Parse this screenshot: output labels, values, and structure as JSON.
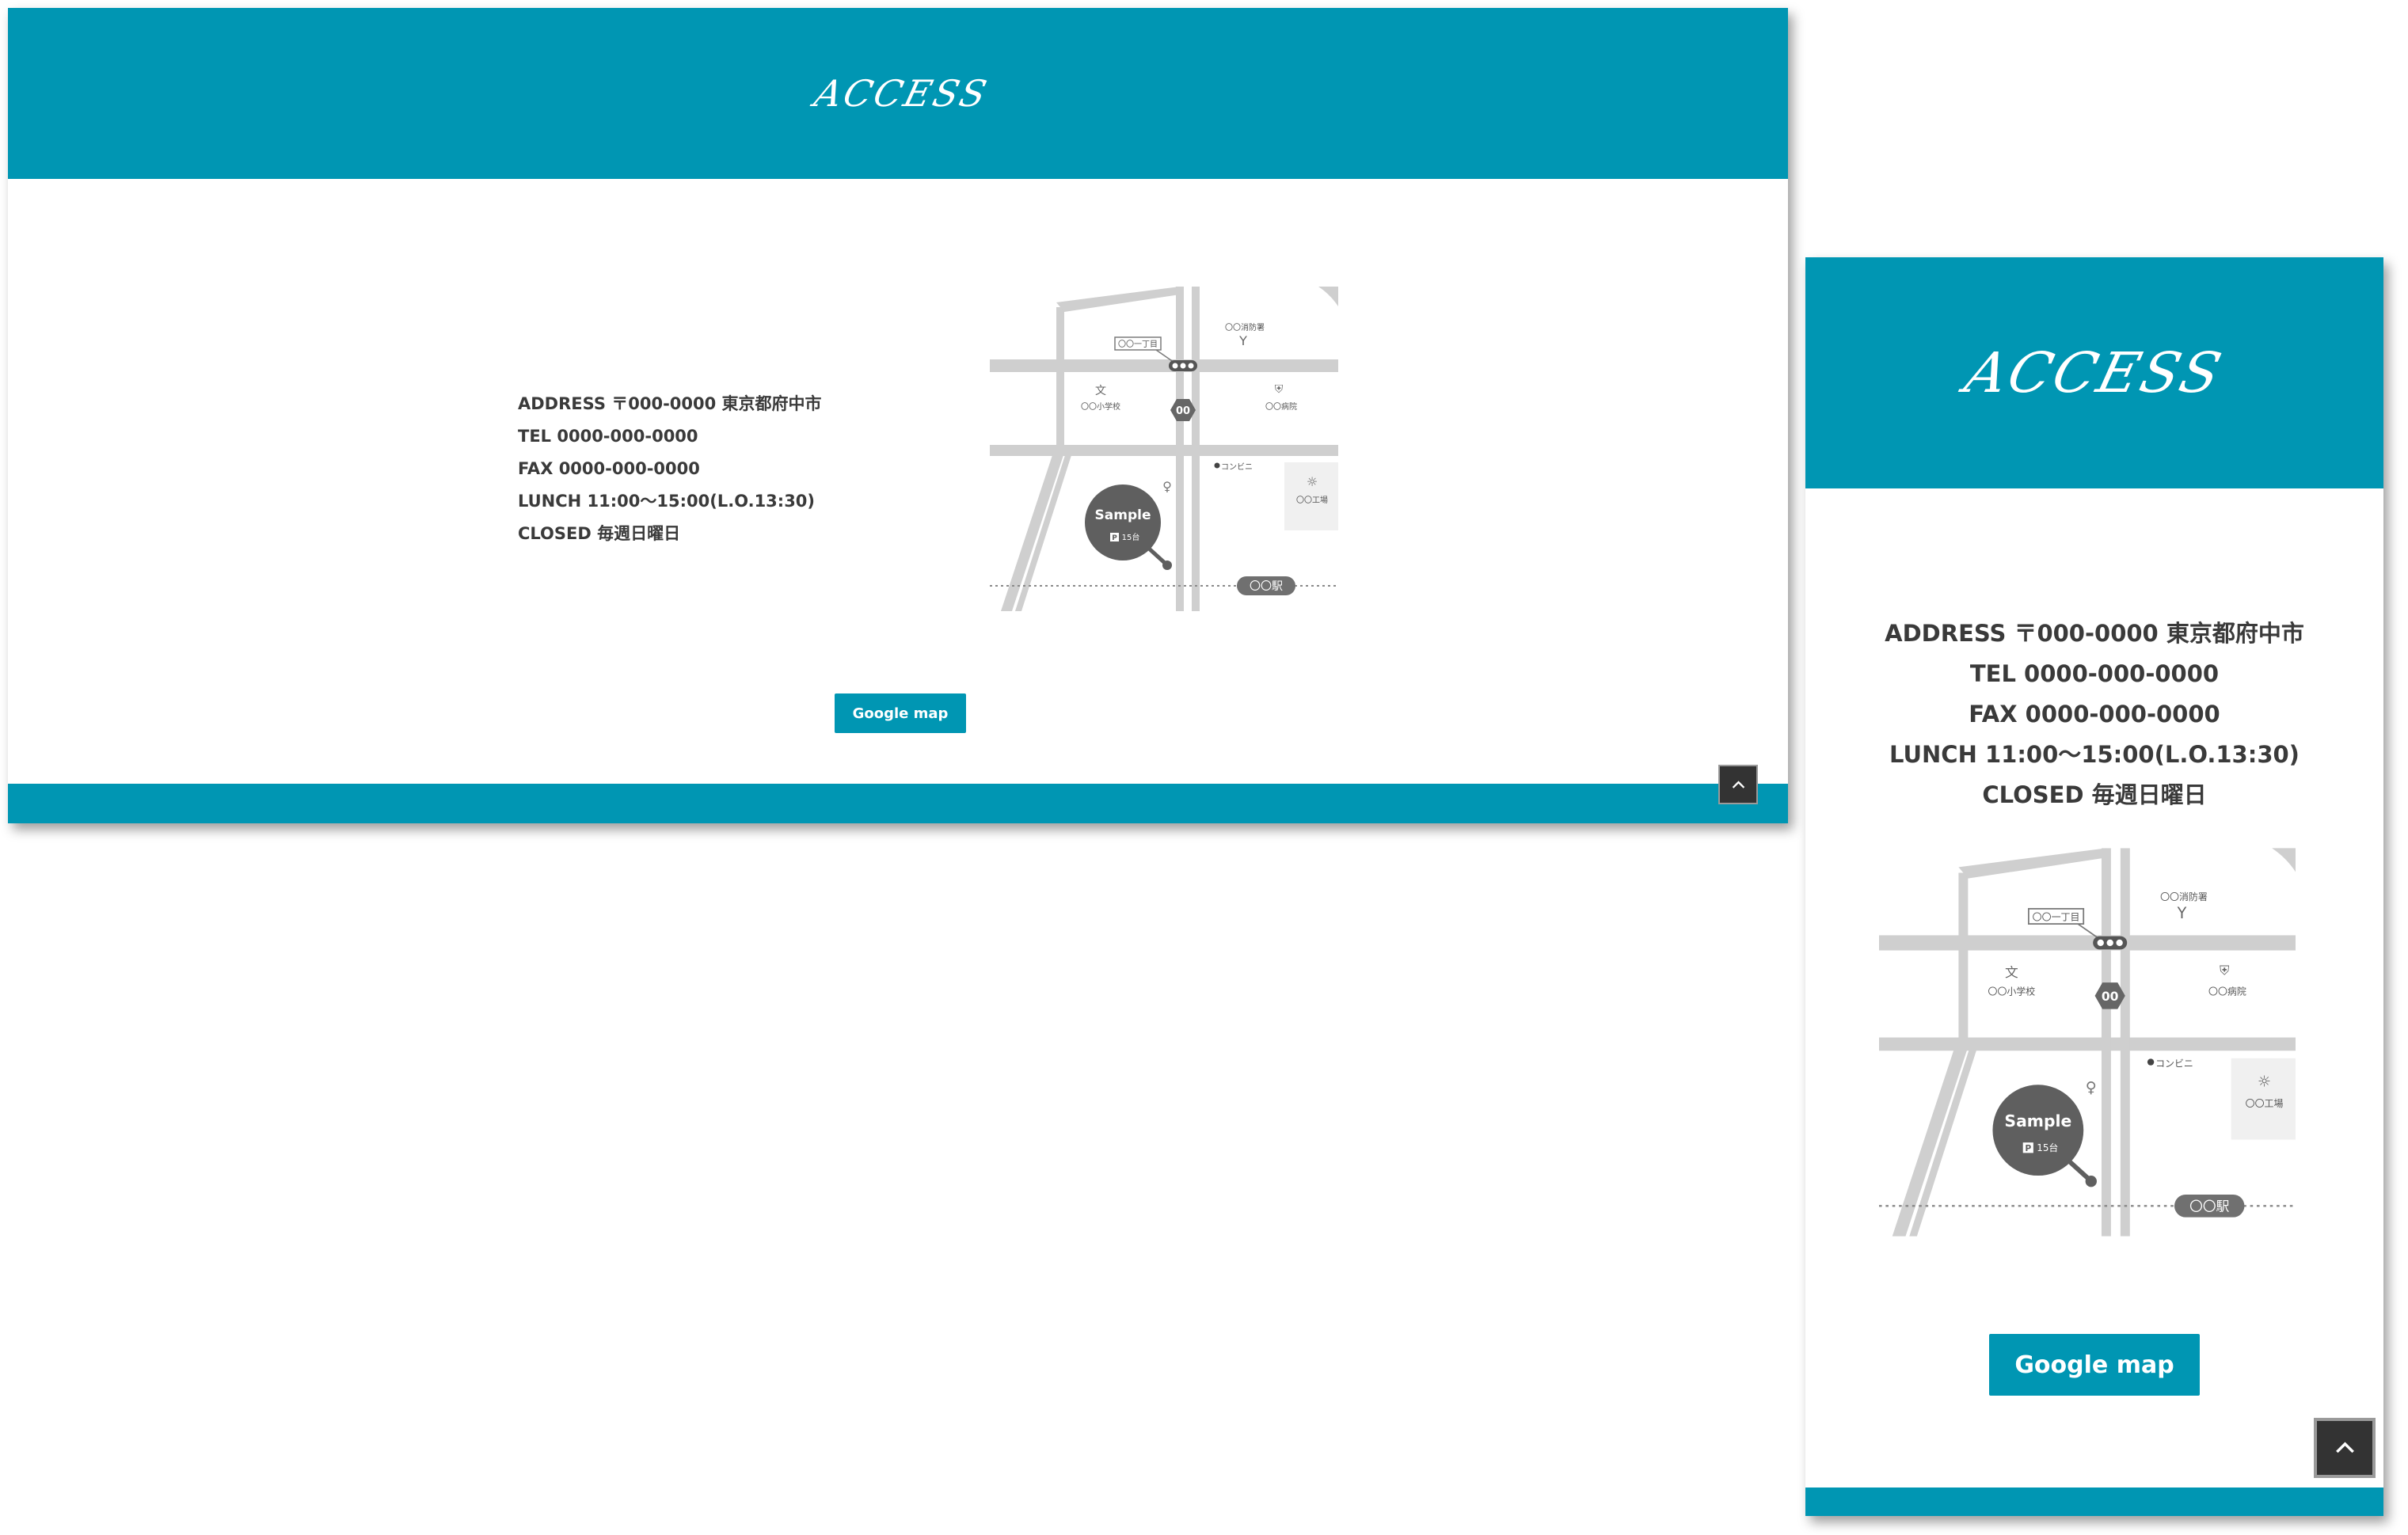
{
  "section": {
    "title": "ACCESS",
    "colors": {
      "accent": "#0096b3",
      "text": "#3a3a3a",
      "road": "#cfcfcf",
      "marker": "#5f5f5f",
      "totop_bg": "#333333"
    }
  },
  "info": {
    "address": "ADDRESS 〒000-0000 東京都府中市",
    "tel": "TEL 0000-000-0000",
    "fax": "FAX 0000-000-0000",
    "lunch": "LUNCH 11:00～15:00(L.O.13:30)",
    "closed": "CLOSED 毎週日曜日"
  },
  "map": {
    "marker_label": "Sample",
    "parking": "P",
    "parking_note": "15台",
    "intersection": "〇〇一丁目",
    "route_badge": "00",
    "fire_station": "〇〇消防署",
    "school": "〇〇小学校",
    "hospital": "〇〇病院",
    "convenience": "コンビニ",
    "factory": "〇〇工場",
    "station": "〇〇駅"
  },
  "buttons": {
    "google_map": "Google map",
    "back_to_top_icon": "chevron-up-icon"
  }
}
